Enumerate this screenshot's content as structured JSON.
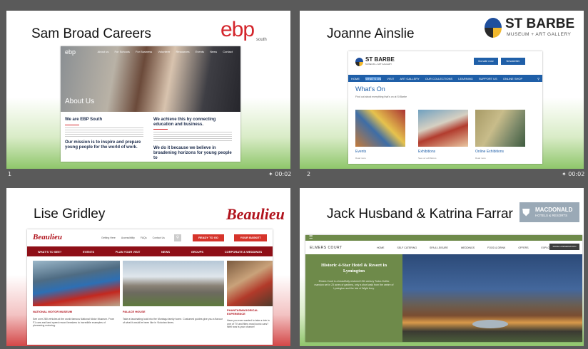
{
  "slides": [
    {
      "number": "1",
      "time": "00:02",
      "title": "Sam Broad   Careers",
      "logo_text": "ebp",
      "logo_sub": "south",
      "site": {
        "brand": "ebp",
        "nav": [
          "About us",
          "For Schools",
          "For Business",
          "Volunteer",
          "Resources",
          "Events",
          "News",
          "Contact"
        ],
        "hero_text": "About Us",
        "col1_heading": "We are EBP South",
        "col1_heading2": "Our mission is to inspire and prepare young people for the world of work.",
        "col2_heading": "We achieve this by connecting education and business.",
        "col2_heading2": "We do it because we believe in broadening horizons for young people to"
      }
    },
    {
      "number": "2",
      "time": "00:02",
      "title": "Joanne Ainslie",
      "logo_text": "ST BARBE",
      "logo_sub": "MUSEUM + ART GALLERY",
      "site": {
        "brand": "ST BARBE",
        "brand_sub": "MUSEUM + ART GALLERY",
        "btn1": "Donate now",
        "btn2": "Newsletter",
        "nav": [
          "HOME",
          "WHAT'S ON",
          "VISIT",
          "ART GALLERY",
          "OUR COLLECTIONS",
          "LEARNING",
          "SUPPORT US",
          "ONLINE SHOP"
        ],
        "heading": "What's On",
        "intro": "Find out about everything that's on at St Barbe",
        "cards": [
          {
            "title": "Events",
            "link": "Read more"
          },
          {
            "title": "Exhibitions",
            "link": "See our exhibitions"
          },
          {
            "title": "Online Exhibitions",
            "link": "Read more"
          }
        ]
      }
    },
    {
      "number": "",
      "time": "",
      "title": "Lise Gridley",
      "logo_text": "Beaulieu",
      "site": {
        "brand": "Beaulieu",
        "top_links": [
          "Getting Here",
          "Accessibility",
          "FAQs",
          "Contact Us"
        ],
        "ready_btn": "READY TO GO",
        "basket_btn": "YOUR BASKET",
        "nav": [
          "WHAT'S TO SEE?",
          "EVENTS",
          "PLAN YOUR VISIT",
          "NEWS",
          "GROUPS",
          "CORPORATE & WEDDINGS"
        ],
        "cards": [
          {
            "title": "NATIONAL MOTOR MUSEUM",
            "text": "See over 280 vehicles at the world famous National Motor Museum. From F1 cars and land speed record breakers to incredible examples of pioneering motoring."
          },
          {
            "title": "PALACE HOUSE",
            "text": "Take a fascinating look into the Montagu family home. Costumed guides give you a flavour of what it would've been like in Victorian times."
          },
          {
            "title": "PHANTASMAGORICAL EXPERIENCE",
            "text": "Have you ever wanted to take a ride in one of TV and films most iconic cars? Well now is your chance!"
          }
        ]
      }
    },
    {
      "number": "",
      "time": "",
      "title": "Jack Husband & Katrina Farrar",
      "logo_text": "MACDONALD",
      "logo_sub": "HOTELS & RESORTS",
      "site": {
        "brand": "ELMERS COURT",
        "nav": [
          "HOME",
          "SELF CATERING",
          "SPA & LEISURE",
          "WEDDINGS",
          "FOOD & DRINK",
          "OFFERS",
          "EXPLORE"
        ],
        "book_btn": "MAKE A RESERVATION",
        "hero_heading": "Historic 4-Star Hotel & Resort in Lymington",
        "hero_text": "Elmers Court is a beautifully restored 19th century Tudor-Gothic mansion set in 23 acres of gardens, only a short walk from the centre of Lymington and the Isle of Wight ferry."
      }
    }
  ],
  "colors": {
    "ebp_red": "#d4262c",
    "stbarbe_blue": "#1f5fa8",
    "beaulieu_red": "#b0121c",
    "elmers_green": "#6e8a4a"
  }
}
